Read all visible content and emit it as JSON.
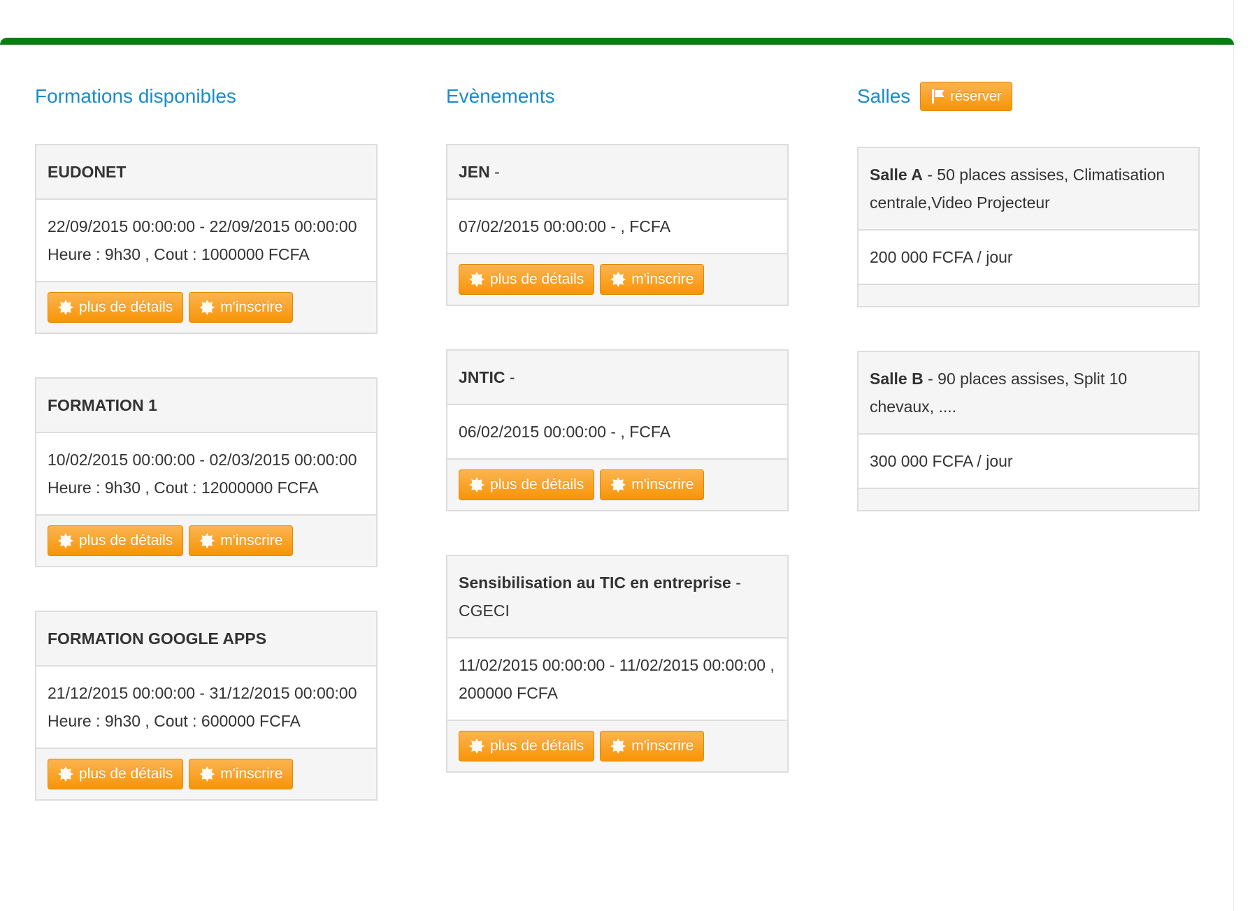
{
  "columns": {
    "formations": {
      "title": "Formations disponibles",
      "items": [
        {
          "name": "EUDONET",
          "dates": "22/09/2015 00:00:00 - 22/09/2015 00:00:00",
          "info": "Heure : 9h30 , Cout : 1000000 FCFA"
        },
        {
          "name": "FORMATION 1",
          "dates": "10/02/2015 00:00:00 - 02/03/2015 00:00:00",
          "info": "Heure : 9h30 , Cout : 12000000 FCFA"
        },
        {
          "name": "FORMATION GOOGLE APPS",
          "dates": "21/12/2015 00:00:00 - 31/12/2015 00:00:00",
          "info": "Heure : 9h30 , Cout : 600000 FCFA"
        }
      ]
    },
    "evenements": {
      "title": "Evènements",
      "items": [
        {
          "name": "JEN",
          "suffix": " -",
          "details": "07/02/2015 00:00:00 - , FCFA"
        },
        {
          "name": "JNTIC",
          "suffix": " -",
          "details": "06/02/2015 00:00:00 - , FCFA"
        },
        {
          "name": "Sensibilisation au TIC en entreprise",
          "suffix": " - CGECI",
          "details": "11/02/2015 00:00:00 - 11/02/2015 00:00:00 , 200000 FCFA"
        }
      ]
    },
    "salles": {
      "title": "Salles",
      "reserve_label": "réserver",
      "items": [
        {
          "name": "Salle A",
          "description": " - 50 places assises, Climatisation centrale,Video Projecteur",
          "price": "200 000 FCFA / jour"
        },
        {
          "name": "Salle B",
          "description": " - 90 places assises, Split 10 chevaux, ....",
          "price": "300 000 FCFA / jour"
        }
      ]
    }
  },
  "buttons": {
    "details_label": "plus de détails",
    "register_label": "m'inscrire",
    "details_icon": "burst-icon",
    "register_icon": "burst-icon",
    "reserve_icon": "flag-icon"
  },
  "colors": {
    "top_bar": "#0a7d12",
    "title": "#1c8bc9",
    "button": "#f89406"
  }
}
